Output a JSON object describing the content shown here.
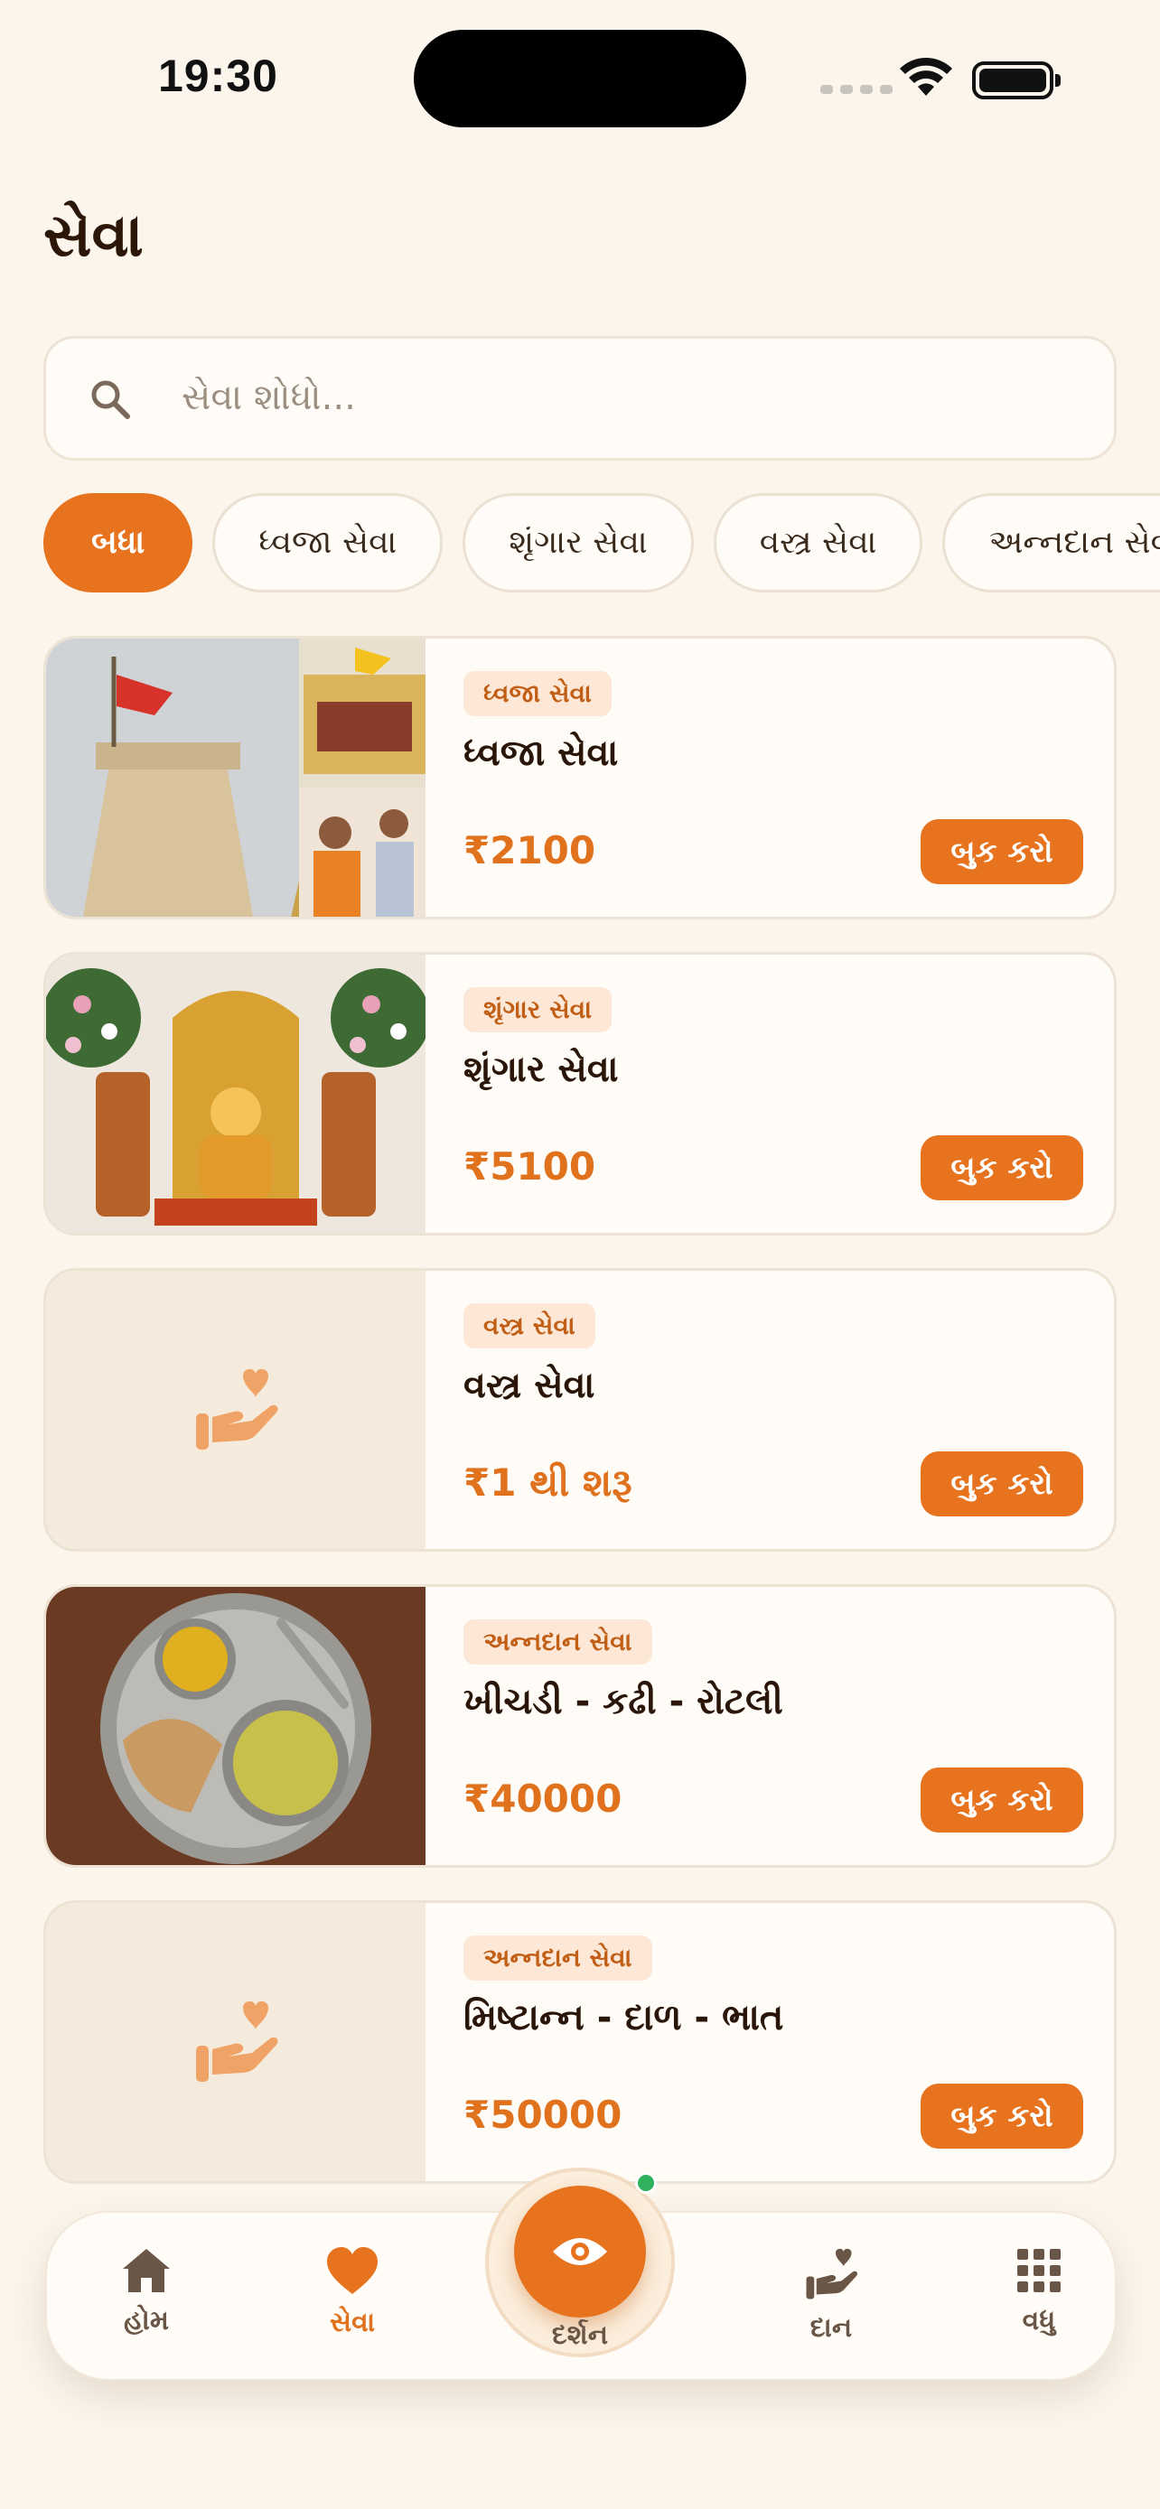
{
  "status_bar": {
    "time": "19:30"
  },
  "page": {
    "title": "સેવા"
  },
  "search": {
    "placeholder": "સેવા શોધો..."
  },
  "filters": [
    {
      "label": "બધા",
      "active": true
    },
    {
      "label": "ધ્વજા સેવા",
      "active": false
    },
    {
      "label": "શૃંગાર સેવા",
      "active": false
    },
    {
      "label": "વસ્ત્ર સેવા",
      "active": false
    },
    {
      "label": "અન્નદાન સેવા",
      "active": false
    }
  ],
  "cards": [
    {
      "tag": "ધ્વજા સેવા",
      "title": "ધ્વજા સેવા",
      "price": "₹2100",
      "button": "બુક કરો",
      "image": "temple-flag-photo"
    },
    {
      "tag": "શૃંગાર સેવા",
      "title": "શૃંગાર સેવા",
      "price": "₹5100",
      "button": "બુક કરો",
      "image": "deity-decoration-photo"
    },
    {
      "tag": "વસ્ત્ર સેવા",
      "title": "વસ્ત્ર સેવા",
      "price": "₹1 થી શરૂ",
      "button": "બુક કરો",
      "image": "hand-heart-icon"
    },
    {
      "tag": "અન્નદાન સેવા",
      "title": "ખીચડી - કઢી - રોટલી",
      "price": "₹40000",
      "button": "બુક કરો",
      "image": "food-thali-photo"
    },
    {
      "tag": "અન્નદાન સેવા",
      "title": "મિષ્ટાન્ન - દાળ - ભાત",
      "price": "₹50000",
      "button": "બુક કરો",
      "image": "hand-heart-icon"
    }
  ],
  "bottom_nav": {
    "home": "હોમ",
    "seva": "સેવા",
    "darshan": "દર્શન",
    "daan": "દાન",
    "more": "વધુ"
  },
  "colors": {
    "accent": "#e8731f",
    "background": "#fbf5ec",
    "card": "#fffcf7"
  }
}
